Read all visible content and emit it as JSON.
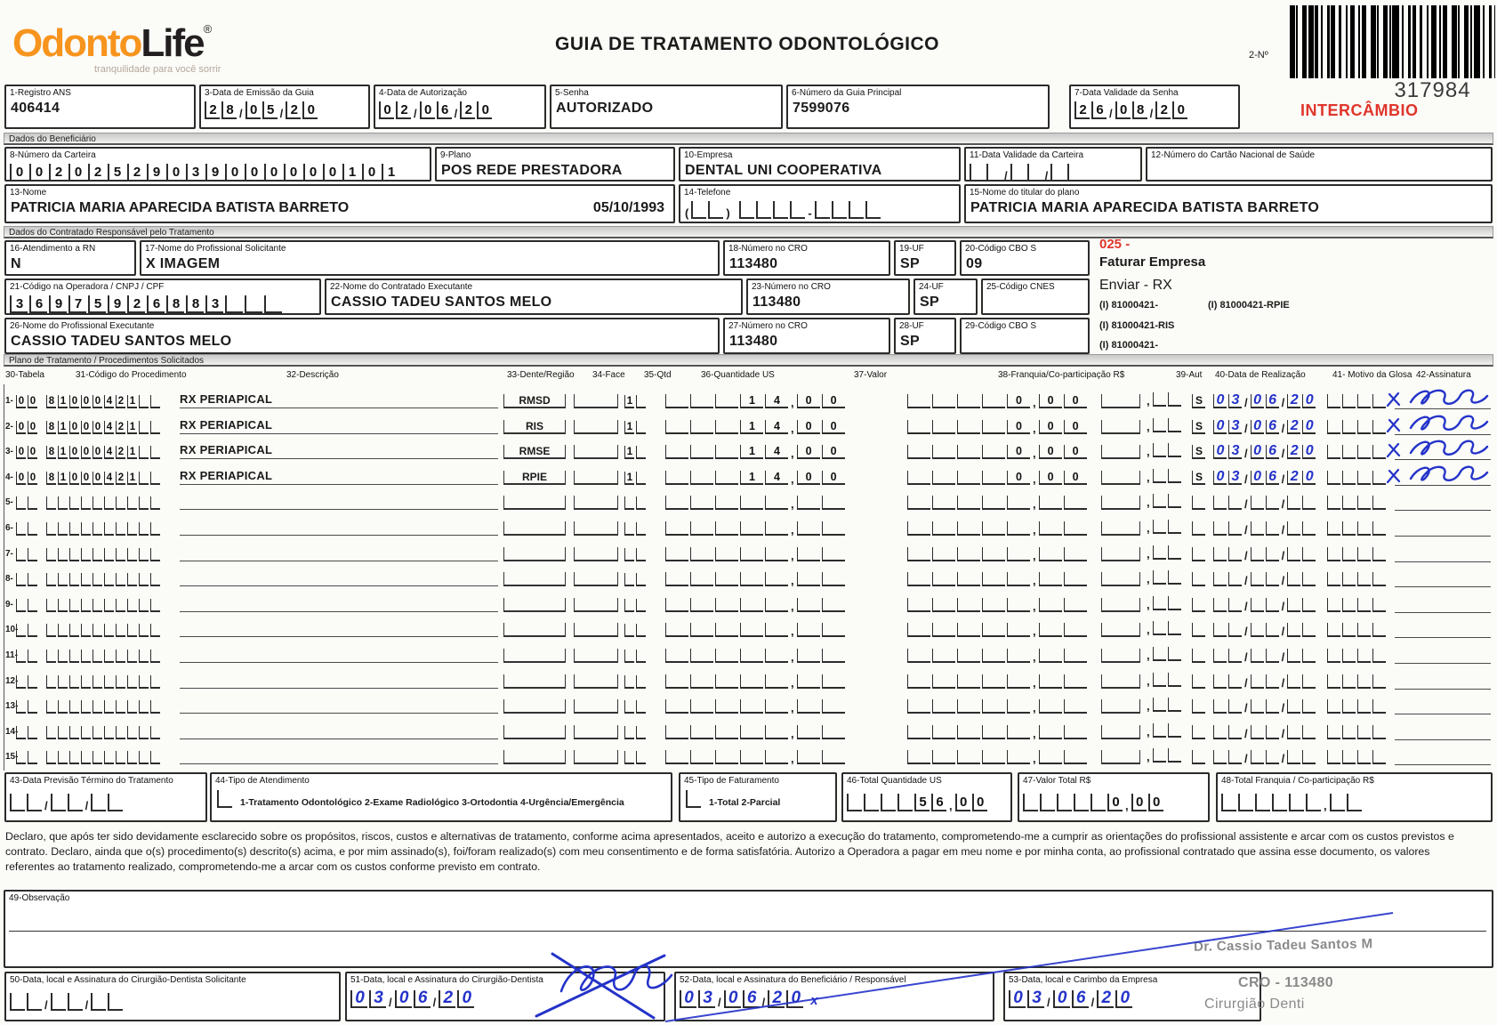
{
  "colors": {
    "accent_orange": "#f7941d",
    "alert_red": "#e0352b",
    "ink_blue": "#2433c9",
    "stamp_gray": "#8a8a8a"
  },
  "brand": {
    "name1": "Odonto",
    "name2": "Life",
    "reg": "®",
    "tagline": "tranquilidade para você sorrir"
  },
  "top": {
    "title": "GUIA DE TRATAMENTO ODONTOLÓGICO",
    "numero_label": "2-Nº",
    "numero": "317984",
    "intercambio": "INTERCÂMBIO",
    "registro": {
      "label": "1-Registro ANS",
      "value": "406414"
    },
    "emissao": {
      "label": "3-Data de Emissão da Guia",
      "value": "280520"
    },
    "autorizacao": {
      "label": "4-Data de Autorização",
      "value": "020620"
    },
    "senha": {
      "label": "5-Senha",
      "value": "AUTORIZADO"
    },
    "guia": {
      "label": "6-Número da Guia Principal",
      "value": "7599076"
    },
    "validade_senha": {
      "label": "7-Data Validade da Senha",
      "value": "260820"
    }
  },
  "sec1": "Dados do Beneficiário",
  "benef": {
    "carteira": {
      "label": "8-Número da Carteira",
      "value": "00202529039000000101"
    },
    "plano": {
      "label": "9-Plano",
      "value": "POS REDE PRESTADORA"
    },
    "empresa": {
      "label": "10-Empresa",
      "value": "DENTAL UNI  COOPERATIVA"
    },
    "validade_carteira": {
      "label": "11-Data Validade da Carteira",
      "value": "      "
    },
    "cartao_nacional": {
      "label": "12-Número do Cartão Nacional de Saúde",
      "value": ""
    },
    "nome": {
      "label": "13-Nome",
      "value": "PATRICIA MARIA APARECIDA BATISTA BARRETO",
      "nascimento": "05/10/1993"
    },
    "telefone": {
      "label": "14-Telefone",
      "value": "          "
    },
    "titular": {
      "label": "15-Nome do titular do plano",
      "value": "PATRICIA MARIA APARECIDA BATISTA BARRETO"
    }
  },
  "sec2": "Dados do Contratado Responsável pelo Tratamento",
  "contratado": {
    "rn": {
      "label": "16-Atendimento a RN",
      "value": "N"
    },
    "solicitante": {
      "label": "17-Nome do Profissional Solicitante",
      "value": "X IMAGEM"
    },
    "cro18": {
      "label": "18-Número no CRO",
      "value": "113480"
    },
    "uf19": {
      "label": "19-UF",
      "value": "SP"
    },
    "cbo20": {
      "label": "20-Código CBO S",
      "value": "09"
    },
    "cnpj": {
      "label": "21-Código na Operadora / CNPJ / CPF",
      "value": "36975926883   "
    },
    "executante": {
      "label": "22-Nome do Contratado Executante",
      "value": "CASSIO TADEU SANTOS MELO"
    },
    "cro23": {
      "label": "23-Número no CRO",
      "value": "113480"
    },
    "uf24": {
      "label": "24-UF",
      "value": "SP"
    },
    "cnes": {
      "label": "25-Código CNES",
      "value": ""
    },
    "prof_exec": {
      "label": "26-Nome do Profissional Executante",
      "value": "CASSIO TADEU SANTOS MELO"
    },
    "cro27": {
      "label": "27-Número no CRO",
      "value": "113480"
    },
    "uf28": {
      "label": "28-UF",
      "value": "SP"
    },
    "cbo29": {
      "label": "29-Código CBO S",
      "value": ""
    },
    "anot": {
      "codigo": "025 -",
      "faturar": "Faturar Empresa",
      "enviar": "Enviar - RX",
      "l1a": "(I) 81000421-",
      "l1b": "(I) 81000421-RPIE",
      "l2": "(I) 81000421-RIS",
      "l3": "(I) 81000421-"
    }
  },
  "sec3": "Plano de Tratamento / Procedimentos Solicitados",
  "table": {
    "headers": [
      "30-Tabela",
      "31-Código do Procedimento",
      "32-Descrição",
      "33-Dente/Região",
      "34-Face",
      "35-Qtd",
      "36-Quantidade US",
      "37-Valor",
      "38-Franquia/Co-participação R$",
      "39-Aut",
      "40-Data de Realização",
      "41- Motivo da Glosa",
      "42-Assinatura"
    ],
    "rows": [
      {
        "num": "1",
        "tabela": "00",
        "codigo": "81000421  ",
        "descricao": "RX PERIAPICAL",
        "dente": "RMSD",
        "face": "",
        "qtd": "1 ",
        "qtd_us": "   1400",
        "valor": "    000",
        "franquia": "  ",
        "aut": "S",
        "data": "030620",
        "motivo": "    ",
        "signed": true
      },
      {
        "num": "2",
        "tabela": "00",
        "codigo": "81000421  ",
        "descricao": "RX PERIAPICAL",
        "dente": "RIS",
        "face": "",
        "qtd": "1 ",
        "qtd_us": "   1400",
        "valor": "    000",
        "franquia": "  ",
        "aut": "S",
        "data": "030620",
        "motivo": "    ",
        "signed": true
      },
      {
        "num": "3",
        "tabela": "00",
        "codigo": "81000421  ",
        "descricao": "RX PERIAPICAL",
        "dente": "RMSE",
        "face": "",
        "qtd": "1 ",
        "qtd_us": "   1400",
        "valor": "    000",
        "franquia": "  ",
        "aut": "S",
        "data": "030620",
        "motivo": "    ",
        "signed": true
      },
      {
        "num": "4",
        "tabela": "00",
        "codigo": "81000421  ",
        "descricao": "RX PERIAPICAL",
        "dente": "RPIE",
        "face": "",
        "qtd": "1 ",
        "qtd_us": "   1400",
        "valor": "    000",
        "franquia": "  ",
        "aut": "S",
        "data": "030620",
        "motivo": "    ",
        "signed": true
      },
      {
        "num": "5",
        "tabela": "  ",
        "codigo": "          ",
        "descricao": "",
        "dente": "",
        "face": "",
        "qtd": "  ",
        "qtd_us": "       ",
        "valor": "       ",
        "franquia": "  ",
        "aut": " ",
        "data": "      ",
        "motivo": "    ",
        "signed": false
      },
      {
        "num": "6",
        "tabela": "  ",
        "codigo": "          ",
        "descricao": "",
        "dente": "",
        "face": "",
        "qtd": "  ",
        "qtd_us": "       ",
        "valor": "       ",
        "franquia": "  ",
        "aut": " ",
        "data": "      ",
        "motivo": "    ",
        "signed": false
      },
      {
        "num": "7",
        "tabela": "  ",
        "codigo": "          ",
        "descricao": "",
        "dente": "",
        "face": "",
        "qtd": "  ",
        "qtd_us": "       ",
        "valor": "       ",
        "franquia": "  ",
        "aut": " ",
        "data": "      ",
        "motivo": "    ",
        "signed": false
      },
      {
        "num": "8",
        "tabela": "  ",
        "codigo": "          ",
        "descricao": "",
        "dente": "",
        "face": "",
        "qtd": "  ",
        "qtd_us": "       ",
        "valor": "       ",
        "franquia": "  ",
        "aut": " ",
        "data": "      ",
        "motivo": "    ",
        "signed": false
      },
      {
        "num": "9",
        "tabela": "  ",
        "codigo": "          ",
        "descricao": "",
        "dente": "",
        "face": "",
        "qtd": "  ",
        "qtd_us": "       ",
        "valor": "       ",
        "franquia": "  ",
        "aut": " ",
        "data": "      ",
        "motivo": "    ",
        "signed": false
      },
      {
        "num": "10",
        "tabela": "  ",
        "codigo": "          ",
        "descricao": "",
        "dente": "",
        "face": "",
        "qtd": "  ",
        "qtd_us": "       ",
        "valor": "       ",
        "franquia": "  ",
        "aut": " ",
        "data": "      ",
        "motivo": "    ",
        "signed": false
      },
      {
        "num": "11",
        "tabela": "  ",
        "codigo": "          ",
        "descricao": "",
        "dente": "",
        "face": "",
        "qtd": "  ",
        "qtd_us": "       ",
        "valor": "       ",
        "franquia": "  ",
        "aut": " ",
        "data": "      ",
        "motivo": "    ",
        "signed": false
      },
      {
        "num": "12",
        "tabela": "  ",
        "codigo": "          ",
        "descricao": "",
        "dente": "",
        "face": "",
        "qtd": "  ",
        "qtd_us": "       ",
        "valor": "       ",
        "franquia": "  ",
        "aut": " ",
        "data": "      ",
        "motivo": "    ",
        "signed": false
      },
      {
        "num": "13",
        "tabela": "  ",
        "codigo": "          ",
        "descricao": "",
        "dente": "",
        "face": "",
        "qtd": "  ",
        "qtd_us": "       ",
        "valor": "       ",
        "franquia": "  ",
        "aut": " ",
        "data": "      ",
        "motivo": "    ",
        "signed": false
      },
      {
        "num": "14",
        "tabela": "  ",
        "codigo": "          ",
        "descricao": "",
        "dente": "",
        "face": "",
        "qtd": "  ",
        "qtd_us": "       ",
        "valor": "       ",
        "franquia": "  ",
        "aut": " ",
        "data": "      ",
        "motivo": "    ",
        "signed": false
      },
      {
        "num": "15",
        "tabela": "  ",
        "codigo": "          ",
        "descricao": "",
        "dente": "",
        "face": "",
        "qtd": "  ",
        "qtd_us": "       ",
        "valor": "       ",
        "franquia": "  ",
        "aut": " ",
        "data": "      ",
        "motivo": "    ",
        "signed": false
      }
    ]
  },
  "totals": {
    "f43": {
      "label": "43-Data Previsão Término do Tratamento",
      "value": "      "
    },
    "f44": {
      "label": "44-Tipo de Atendimento",
      "check": " ",
      "options": "1-Tratamento Odontológico  2-Exame Radiológico  3-Ortodontia  4-Urgência/Emergência"
    },
    "f45": {
      "label": "45-Tipo de Faturamento",
      "check": " ",
      "options": "1-Total  2-Parcial"
    },
    "f46": {
      "label": "46-Total Quantidade US",
      "value": "    5600"
    },
    "f47": {
      "label": "47-Valor Total R$",
      "value": "     000"
    },
    "f48": {
      "label": "48-Total Franquia / Co-participação R$",
      "value": "        "
    }
  },
  "declaration": {
    "lines": [
      "Declaro, que após ter sido devidamente esclarecido sobre os propósitos, riscos, custos e alternativas de tratamento, conforme acima apresentados, aceito e autorizo a execução do tratamento, comprometendo-me a cumprir as orientações do profissional assistente e arcar com os custos previstos e",
      "contrato. Declaro, ainda que o(s) procedimento(s) descrito(s) acima, e por mim assinado(s), foi/foram realizado(s) com meu consentimento e de forma satisfatória. Autorizo a Operadora a pagar em meu nome e por minha conta, ao profissional contratado que assina esse documento, os valores",
      "referentes ao tratamento realizado, comprometendo-me a arcar com os custos conforme previsto em contrato."
    ]
  },
  "obs": {
    "label": "49-Observação"
  },
  "stamp": {
    "doctor": "Dr. Cassio Tadeu Santos M",
    "cro": "CRO - 113480",
    "title": "Cirurgião Denti"
  },
  "footer": {
    "f50": {
      "label": "50-Data, local e Assinatura do Cirurgião-Dentista Solicitante",
      "value": "      "
    },
    "f51": {
      "label": "51-Data, local e Assinatura do Cirurgião-Dentista",
      "value": "030620"
    },
    "f52": {
      "label": "52-Data, local e Assinatura do Beneficiário / Responsável",
      "value": "030620",
      "mark": "x"
    },
    "f53": {
      "label": "53-Data, local e Carimbo da Empresa",
      "value": "030620"
    }
  }
}
